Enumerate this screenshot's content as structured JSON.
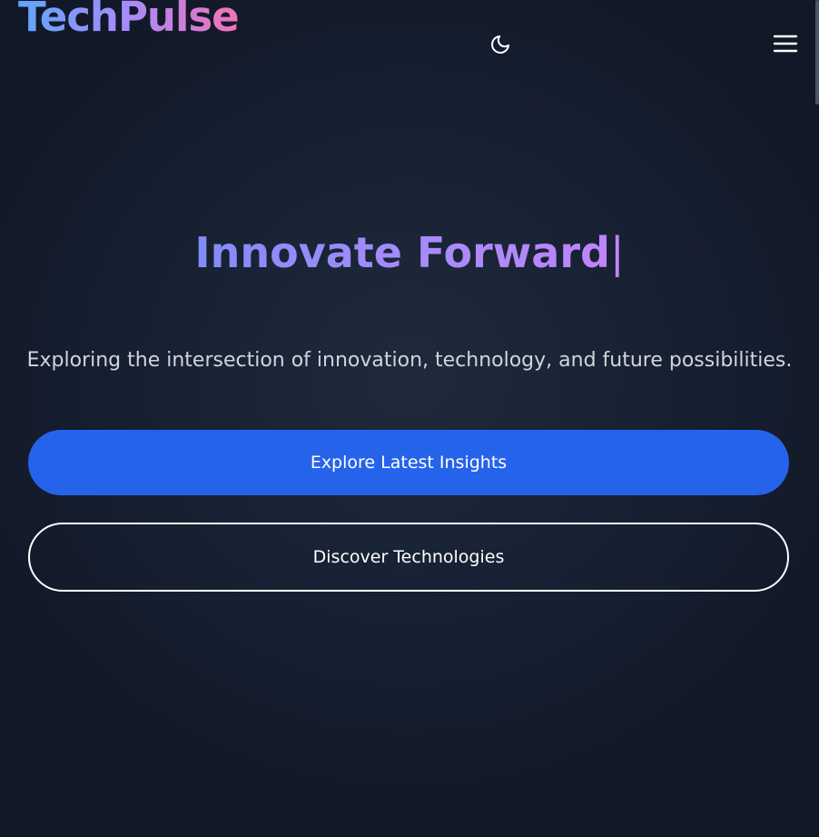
{
  "header": {
    "logo": "TechPulse",
    "theme_toggle_icon": "moon-icon",
    "menu_icon": "hamburger-menu-icon"
  },
  "hero": {
    "title": "Innovate Forward",
    "cursor": "|",
    "subtitle": "Exploring the intersection of innovation, technology, and future possibilities.",
    "primary_button": "Explore Latest Insights",
    "secondary_button": "Discover Technologies"
  },
  "colors": {
    "background": "#111827",
    "primary_button": "#2563eb",
    "logo_gradient": [
      "#60a5fa",
      "#a78bfa",
      "#f472b6"
    ],
    "title_gradient": [
      "#818cf8",
      "#c084fc"
    ]
  }
}
